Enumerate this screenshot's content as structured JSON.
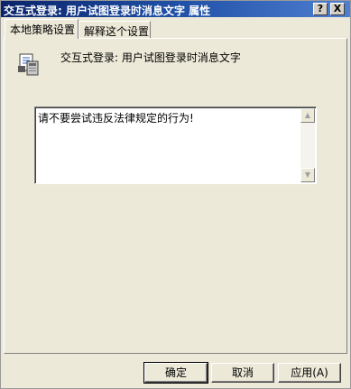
{
  "window": {
    "title": "交互式登录: 用户试图登录时消息文字 属性",
    "help_button": "?",
    "close_button": "X"
  },
  "tabs": [
    {
      "label": "本地策略设置",
      "active": true
    },
    {
      "label": "解释这个设置",
      "active": false
    }
  ],
  "policy": {
    "icon": "policy-computer-icon",
    "name": "交互式登录: 用户试图登录时消息文字"
  },
  "message": {
    "value": "请不要尝试违反法律规定的行为!"
  },
  "buttons": {
    "ok": "确定",
    "cancel": "取消",
    "apply": "应用(A)"
  },
  "colors": {
    "title_bar": "#0a246a",
    "dialog_bg": "#ece9d8"
  }
}
